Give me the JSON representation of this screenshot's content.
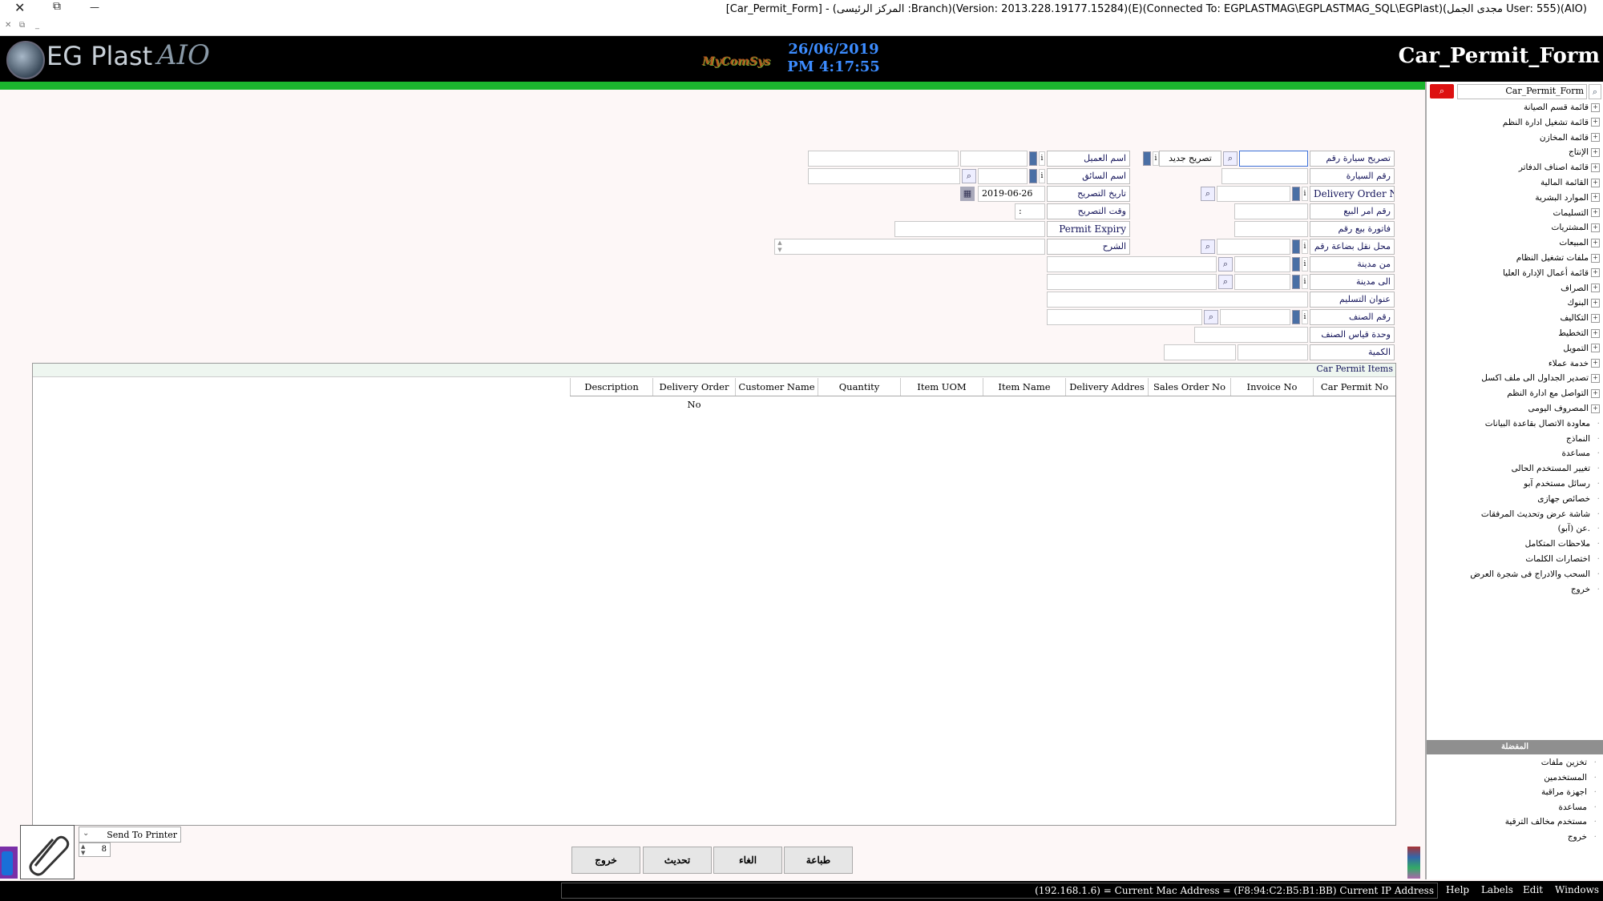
{
  "window": {
    "title": "[Car_Permit_Form] - (المركز الرئيسى :Branch)(Version: 2013.228.19177.15284)(E)(Connected To: EGPLASTMAG\\EGPLASTMAG_SQL\\EGPlast)(مجدى الجمل User: 555)(AIO)",
    "close_glyph": "✕",
    "restore_glyph": "⧉",
    "minimize_glyph": "—"
  },
  "header": {
    "logo_text": "EG Plast",
    "logo_aio": "AIO",
    "mycomsys": "MyComSys",
    "date": "26/06/2019",
    "time": "PM 4:17:55",
    "form_title": "Car_Permit_Form"
  },
  "search": {
    "value": "Car_Permit_Form",
    "button_glyph": "🔍",
    "icon_glyph": "⌕"
  },
  "tree": [
    {
      "label": "قائمة قسم الصيانة",
      "exp": "+"
    },
    {
      "label": "قائمة تشغيل ادارة النظم",
      "exp": "+"
    },
    {
      "label": "قائمة المخازن",
      "exp": "+"
    },
    {
      "label": "الإنتاج",
      "exp": "+"
    },
    {
      "label": "قائمة اصناف الدفاتر",
      "exp": "+"
    },
    {
      "label": "القائمة المالية",
      "exp": "+"
    },
    {
      "label": "الموارد البشرية",
      "exp": "+"
    },
    {
      "label": "التسليمات",
      "exp": "+"
    },
    {
      "label": "المشتريات",
      "exp": "+"
    },
    {
      "label": "المبيعات",
      "exp": "+"
    },
    {
      "label": "ملفات تشغيل النظام",
      "exp": "+"
    },
    {
      "label": "قائمة أعمال الإدارة العليا",
      "exp": "+"
    },
    {
      "label": "الصراف",
      "exp": "+"
    },
    {
      "label": "البنوك",
      "exp": "+"
    },
    {
      "label": "التكاليف",
      "exp": "+"
    },
    {
      "label": "التخطيط",
      "exp": "+"
    },
    {
      "label": "التمويل",
      "exp": "+"
    },
    {
      "label": "خدمة عملاء",
      "exp": "+"
    },
    {
      "label": "تصدير الجداول الى ملف اكسل",
      "exp": "+"
    },
    {
      "label": "التواصل مع ادارة النظم",
      "exp": "+"
    },
    {
      "label": "المصروف اليومى",
      "exp": "+"
    },
    {
      "label": "معاودة الاتصال بقاعدة البيانات",
      "exp": ""
    },
    {
      "label": "النماذج",
      "exp": ""
    },
    {
      "label": "مساعدة",
      "exp": ""
    },
    {
      "label": "تغيير المستخدم الحالى",
      "exp": ""
    },
    {
      "label": "رسائل مستخدم آبو",
      "exp": ""
    },
    {
      "label": "خصائص جهازى",
      "exp": ""
    },
    {
      "label": "شاشة عرض وتحديث المرفقات",
      "exp": ""
    },
    {
      "label": "عن (آبو).",
      "exp": ""
    },
    {
      "label": "ملاحظات المتكامل",
      "exp": ""
    },
    {
      "label": "اختصارات الكلمات",
      "exp": ""
    },
    {
      "label": "السحب والادراج فى شجرة العرض",
      "exp": ""
    },
    {
      "label": "خروج",
      "exp": ""
    }
  ],
  "favorites": {
    "title": "المفضلة",
    "items": [
      "تخزين ملفات",
      "المستخدمين",
      "اجهزة مراقبة",
      "مساعدة",
      "مستخدم مخالف الترقية",
      "خروج"
    ]
  },
  "form": {
    "car_permit_no_label": "تصريح سيارة رقم",
    "new_permit_label": "تصريح جديد",
    "customer_name_label": "اسم العميل",
    "car_no_label": "رقم السيارة",
    "driver_name_label": "اسم السائق",
    "delivery_order_label": "Delivery Order No",
    "permit_date_label": "تاريخ التصريح",
    "permit_date_value": "2019-06-26",
    "sales_order_label": "رقم امر البيع",
    "permit_time_label": "وقت التصريح",
    "permit_time_value": ":",
    "invoice_label": "فاتورة بيع رقم",
    "permit_expiry_label": "Permit Expiry",
    "transfer_label": "محل نقل بضاعة رقم",
    "description_label": "الشرح",
    "from_city_label": "من مدينة",
    "to_city_label": "الى مدينة",
    "delivery_address_label": "عنوان التسليم",
    "item_no_label": "رقم الصنف",
    "uom_label": "وحدة قياس الصنف",
    "quantity_label": "الكمية",
    "info_glyph": "i",
    "search_glyph": "⌕"
  },
  "grid": {
    "title": "Car Permit Items",
    "columns": [
      "Car Permit No",
      "Invoice No",
      "Sales Order No",
      "Delivery Addres",
      "Item Name",
      "Item UOM",
      "Quantity",
      "Customer Name",
      "Delivery Order No",
      "Description"
    ]
  },
  "bottom": {
    "printer": "Send To Printer",
    "copies": "8",
    "buttons": {
      "print": "طباعة",
      "cancel": "الغاء",
      "update": "تحديث",
      "exit": "خروج"
    },
    "clip_glyph": "📎"
  },
  "status": {
    "ip_text": "(192.168.1.6) = Current Mac Address = (F8:94:C2:B5:B1:BB) Current IP Address",
    "menus": [
      "Help",
      "Labels",
      "Edit",
      "Windows"
    ]
  },
  "colors": {
    "header_bg": "#000000",
    "accent_green": "#1bb52e",
    "date_blue": "#3c8cff"
  }
}
